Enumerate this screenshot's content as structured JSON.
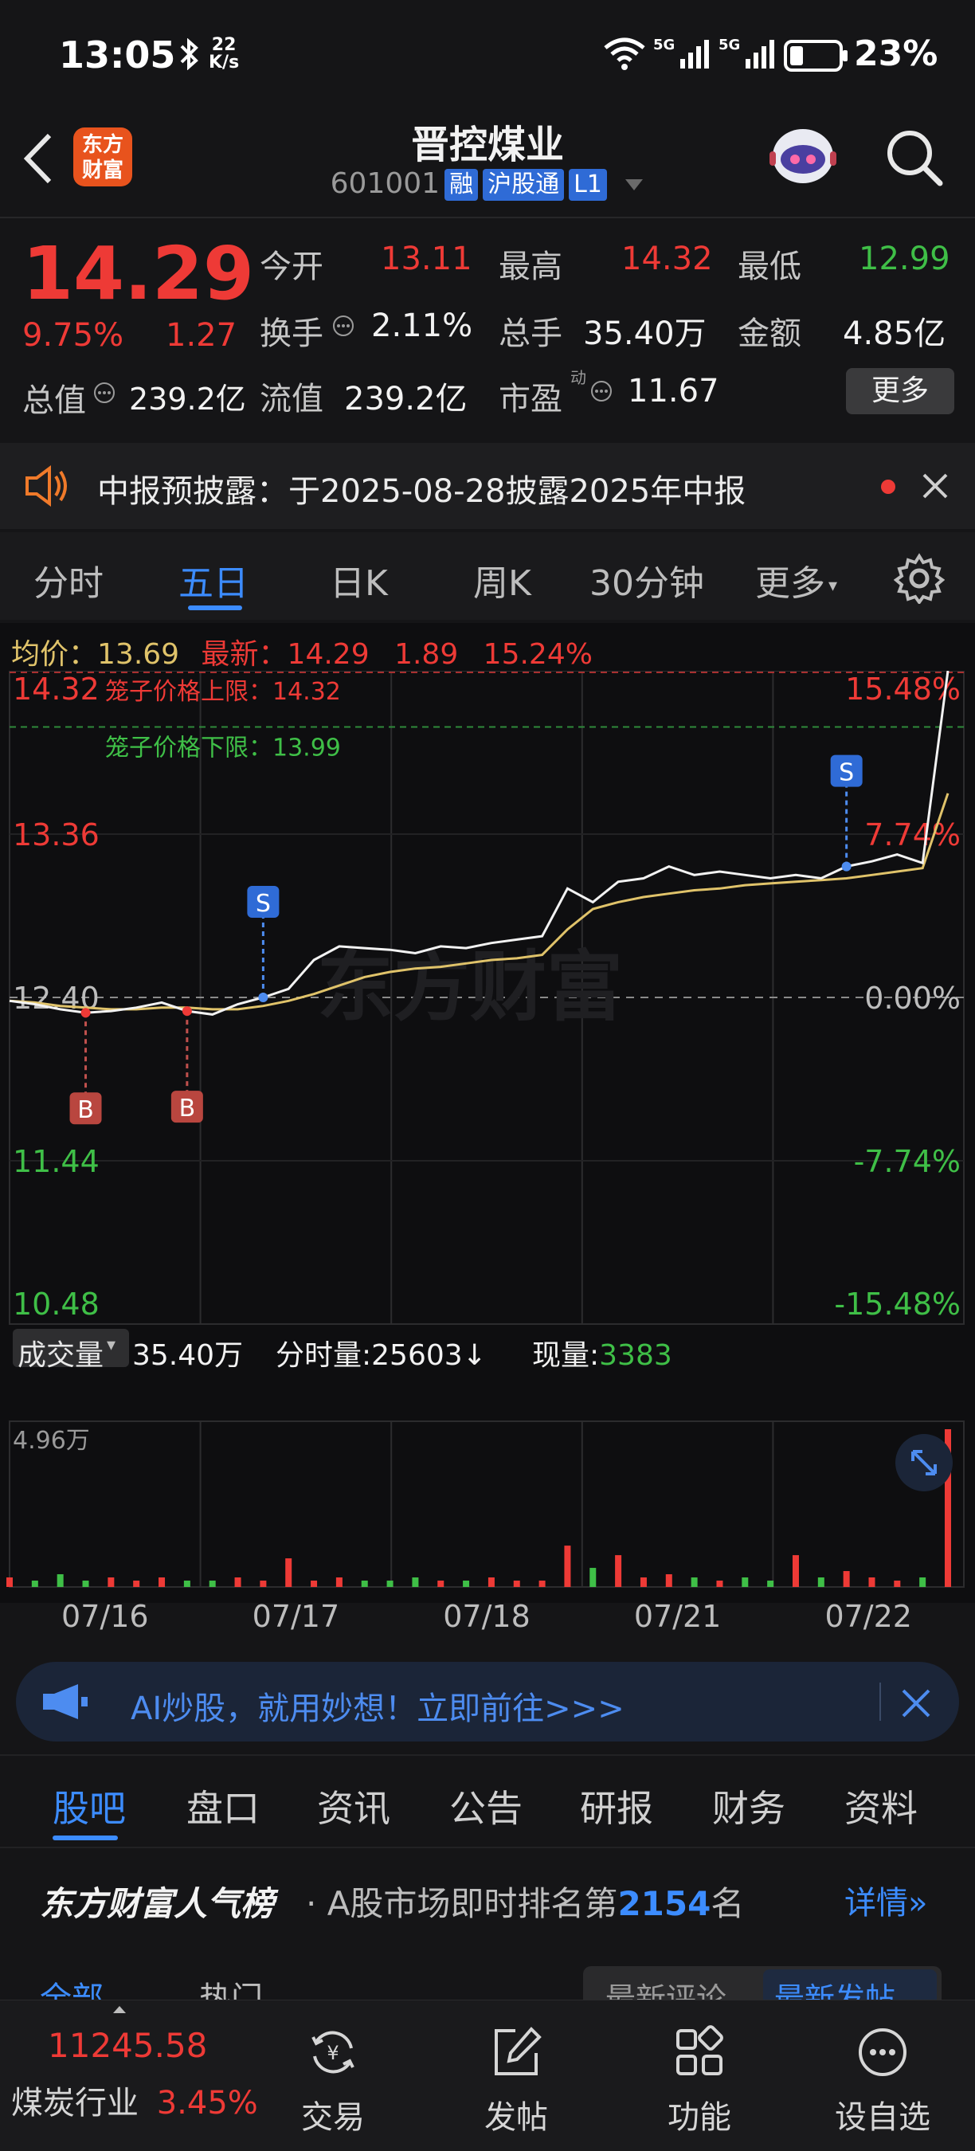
{
  "status": {
    "time": "13:05",
    "netspeed_top": "22",
    "netspeed_bottom": "K/s",
    "battery": "23%"
  },
  "header": {
    "title": "晋控煤业",
    "code": "601001",
    "tags": [
      "融",
      "沪股通",
      "L1"
    ],
    "logo_line1": "东方",
    "logo_line2": "财富"
  },
  "quote": {
    "price": "14.29",
    "change_pct": "9.75%",
    "change": "1.27",
    "open_label": "今开",
    "open": "13.11",
    "high_label": "最高",
    "high": "14.32",
    "low_label": "最低",
    "low": "12.99",
    "turnover_label": "换手",
    "turnover": "2.11%",
    "volume_label": "总手",
    "volume": "35.40万",
    "amount_label": "金额",
    "amount": "4.85亿",
    "mcap_label": "总值",
    "mcap": "239.2亿",
    "float_label": "流值",
    "float": "239.2亿",
    "pe_label": "市盈",
    "pe_sup": "动",
    "pe": "11.67",
    "more": "更多"
  },
  "notice": {
    "text": "中报预披露：于2025-08-28披露2025年中报"
  },
  "chart_tabs": [
    "分时",
    "五日",
    "日K",
    "周K",
    "30分钟",
    "更多"
  ],
  "chart_info": {
    "avg_label": "均价：",
    "avg": "13.69",
    "latest_label": "最新：",
    "latest": "14.29",
    "chg": "1.89",
    "chg_pct": "15.24%"
  },
  "chart_labels": {
    "upper_limit": "笼子价格上限：14.32",
    "lower_limit": "笼子价格下限：13.99",
    "watermark": "东方财富",
    "buy": "B",
    "sell": "S"
  },
  "volume_info": {
    "selector": "成交量",
    "total": "35.40万",
    "tick_label": "分时量:",
    "tick": "25603",
    "tick_arrow": "↓",
    "now_label": "现量:",
    "now": "3383",
    "ymax": "4.96万"
  },
  "chart_data": {
    "type": "line",
    "title": "",
    "x_labels": [
      "07/16",
      "07/17",
      "07/18",
      "07/21",
      "07/22"
    ],
    "y_ticks_left": [
      "14.32",
      "13.36",
      "12.40",
      "11.44",
      "10.48"
    ],
    "y_ticks_right": [
      "15.48%",
      "7.74%",
      "0.00%",
      "-7.74%",
      "-15.48%"
    ],
    "ylim": [
      10.48,
      14.32
    ],
    "base": 12.4,
    "series": [
      {
        "values": [
          12.38,
          12.36,
          12.33,
          12.31,
          12.32,
          12.34,
          12.37,
          12.32,
          12.3,
          12.36,
          12.4,
          12.45,
          12.62,
          12.7,
          12.69,
          12.68,
          12.66,
          12.7,
          12.69,
          12.72,
          12.74,
          12.76,
          13.04,
          12.96,
          13.08,
          13.1,
          13.17,
          13.12,
          13.14,
          13.12,
          13.1,
          13.12,
          13.1,
          13.17,
          13.2,
          13.24,
          13.19,
          14.32
        ]
      },
      {
        "values": [
          12.38,
          12.37,
          12.35,
          12.34,
          12.33,
          12.33,
          12.34,
          12.34,
          12.33,
          12.33,
          12.35,
          12.38,
          12.42,
          12.47,
          12.52,
          12.55,
          12.57,
          12.58,
          12.6,
          12.62,
          12.63,
          12.65,
          12.8,
          12.92,
          12.96,
          12.99,
          13.01,
          13.03,
          13.04,
          13.06,
          13.07,
          13.08,
          13.09,
          13.1,
          13.12,
          13.14,
          13.16,
          13.6
        ]
      }
    ],
    "volume_ylim": [
      0,
      4.96
    ],
    "volume_values": [
      0.3,
      0.2,
      0.4,
      0.2,
      0.3,
      0.2,
      0.3,
      0.2,
      0.2,
      0.3,
      0.2,
      0.9,
      0.2,
      0.3,
      0.2,
      0.2,
      0.3,
      0.2,
      0.2,
      0.3,
      0.2,
      0.2,
      1.3,
      0.6,
      1.0,
      0.3,
      0.4,
      0.3,
      0.2,
      0.3,
      0.2,
      1.0,
      0.3,
      0.5,
      0.3,
      0.2,
      0.3,
      4.96
    ]
  },
  "ad": {
    "text": "AI炒股，就用妙想！立即前往>>>"
  },
  "sections": [
    "股吧",
    "盘口",
    "资讯",
    "公告",
    "研报",
    "财务",
    "资料"
  ],
  "rank": {
    "brand": "东方财富人气榜",
    "text_pre": "A股市场即时排名第",
    "number": "2154",
    "text_post": "名",
    "detail": "详情"
  },
  "partial_tabs": {
    "all": "全部",
    "hot": "热门",
    "latest_comment": "最新评论",
    "latest_post": "最新发帖"
  },
  "bottom_nav": {
    "index": "11245.58",
    "sector": "煤炭行业",
    "sector_pct": "3.45%",
    "items": [
      "交易",
      "发帖",
      "功能",
      "设自选"
    ]
  },
  "colors": {
    "up": "#ee3a36",
    "down": "#3fbf47",
    "accent": "#3c8cff",
    "avg_line": "#e0c36a"
  }
}
